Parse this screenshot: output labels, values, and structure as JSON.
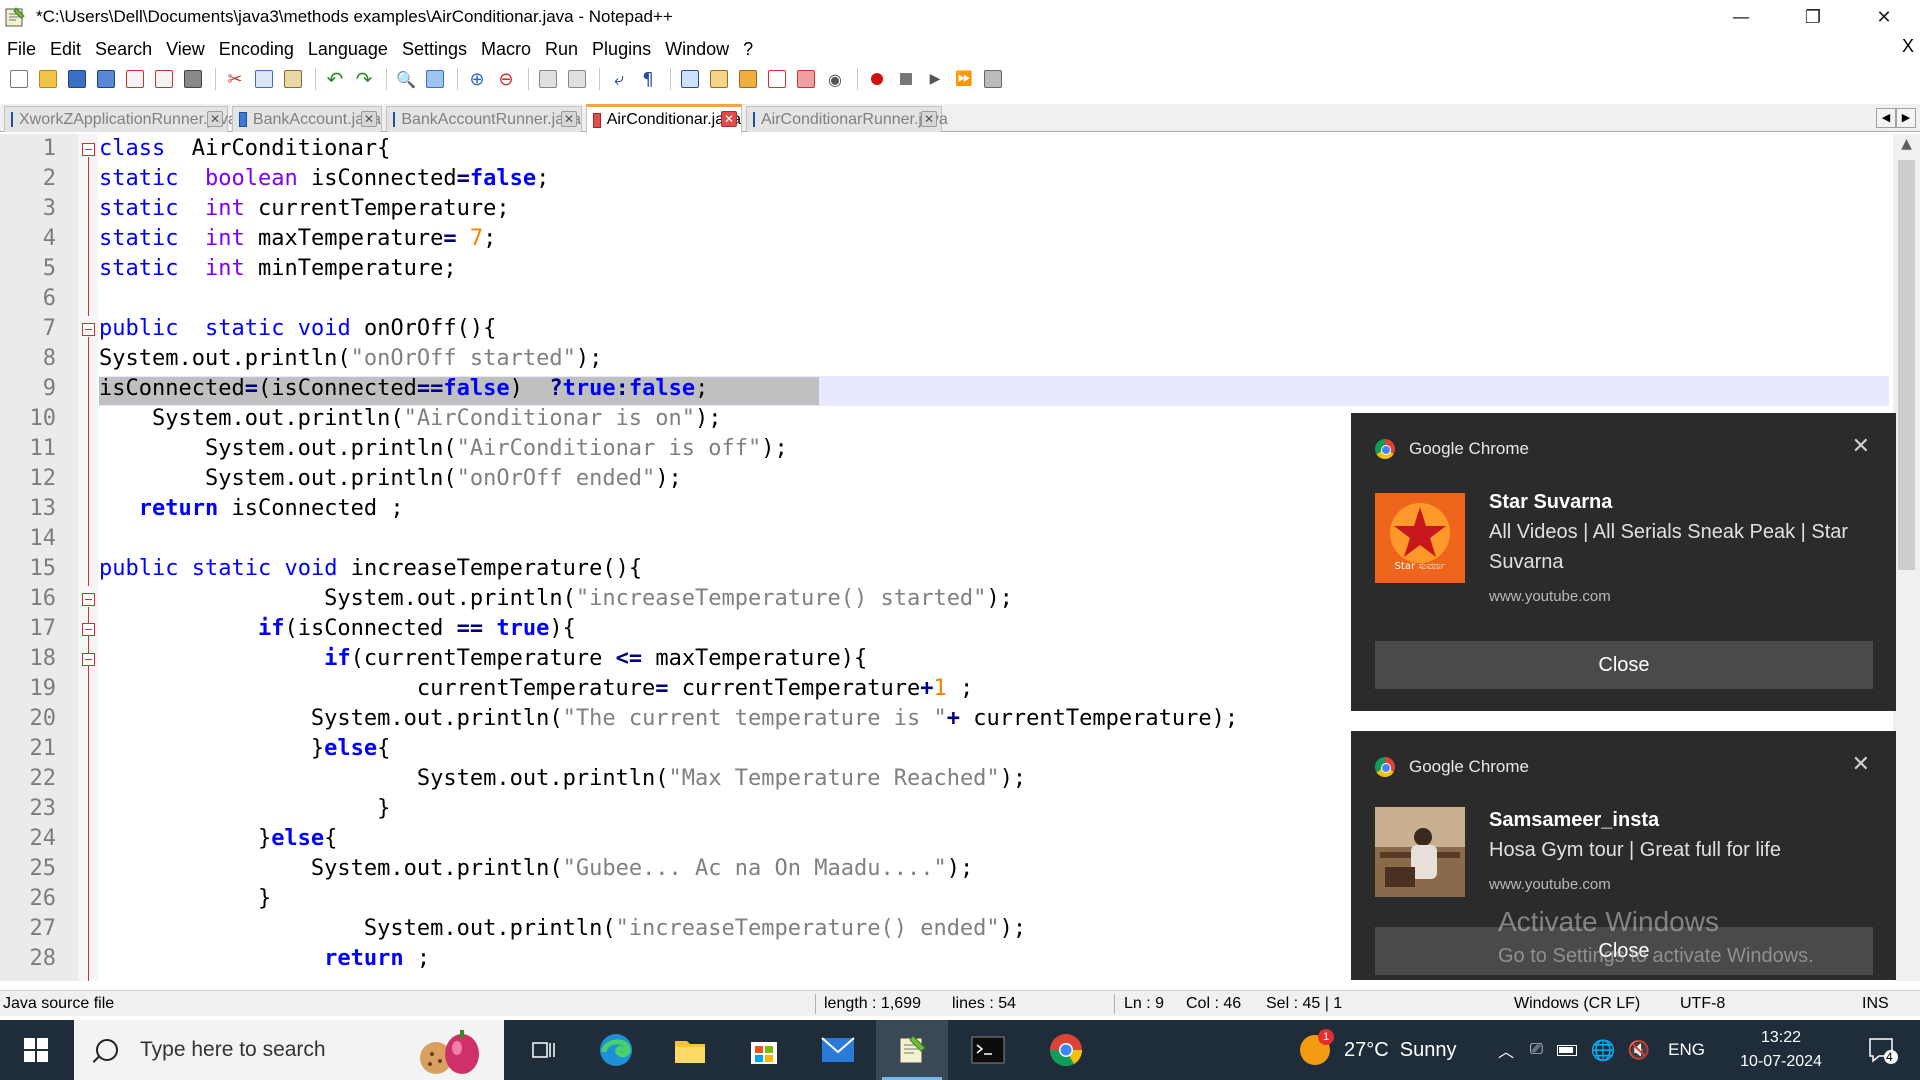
{
  "window": {
    "title": "*C:\\Users\\Dell\\Documents\\java3\\methods examples\\AirConditionar.java - Notepad++",
    "minimize": "—",
    "maximize": "❐",
    "close": "✕",
    "menu_close": "X"
  },
  "menu": [
    "File",
    "Edit",
    "Search",
    "View",
    "Encoding",
    "Language",
    "Settings",
    "Macro",
    "Run",
    "Plugins",
    "Window",
    "?"
  ],
  "tabs": [
    {
      "label": "XworkZApplicationRunner.java",
      "active": false
    },
    {
      "label": "BankAccount.java",
      "active": false
    },
    {
      "label": "BankAccountRunner.java",
      "active": false
    },
    {
      "label": "AirConditionar.java",
      "active": true
    },
    {
      "label": "AirConditionarRunner.java",
      "active": false
    }
  ],
  "tab_close_glyph": "✕",
  "tab_nav": {
    "left": "◀",
    "right": "▶"
  },
  "editor": {
    "line_numbers": [
      "1",
      "2",
      "3",
      "4",
      "5",
      "6",
      "7",
      "8",
      "9",
      "10",
      "11",
      "12",
      "13",
      "14",
      "15",
      "16",
      "17",
      "18",
      "19",
      "20",
      "21",
      "22",
      "23",
      "24",
      "25",
      "26",
      "27",
      "28"
    ],
    "current_line": 9
  },
  "status": {
    "file_type": "Java source file",
    "length": "length : 1,699",
    "lines": "lines : 54",
    "ln": "Ln : 9",
    "col": "Col : 46",
    "sel": "Sel : 45 | 1",
    "eol": "Windows (CR LF)",
    "encoding": "UTF-8",
    "mode": "INS"
  },
  "toasts": [
    {
      "app": "Google Chrome",
      "title": "Star Suvarna",
      "body": "All Videos | All Serials Sneak Peak | Star Suvarna",
      "source": "www.youtube.com",
      "button": "Close",
      "thumb_text": "Star ಸುವರ್ಣ",
      "close_glyph": "✕"
    },
    {
      "app": "Google Chrome",
      "title": "Samsameer_insta",
      "body": "Hosa Gym tour | Great full for life",
      "source": "www.youtube.com",
      "button": "Close",
      "close_glyph": "✕"
    }
  ],
  "watermark": {
    "line1": "Activate Windows",
    "line2": "Go to Settings to activate Windows."
  },
  "taskbar": {
    "search_placeholder": "Type here to search",
    "weather_badge": "1",
    "weather": "27°C  Sunny",
    "language": "ENG",
    "time": "13:22",
    "date": "10-07-2024",
    "notif_count": "4"
  },
  "colors": {
    "keyword": "#0000ff",
    "type_keyword": "#8000ff",
    "string": "#808080",
    "number": "#ff8000",
    "operator": "#000080",
    "active_tab_accent": "#f7a43a",
    "toast_bg": "#2b2b2b",
    "taskbar_bg": "#1f2d3a"
  }
}
